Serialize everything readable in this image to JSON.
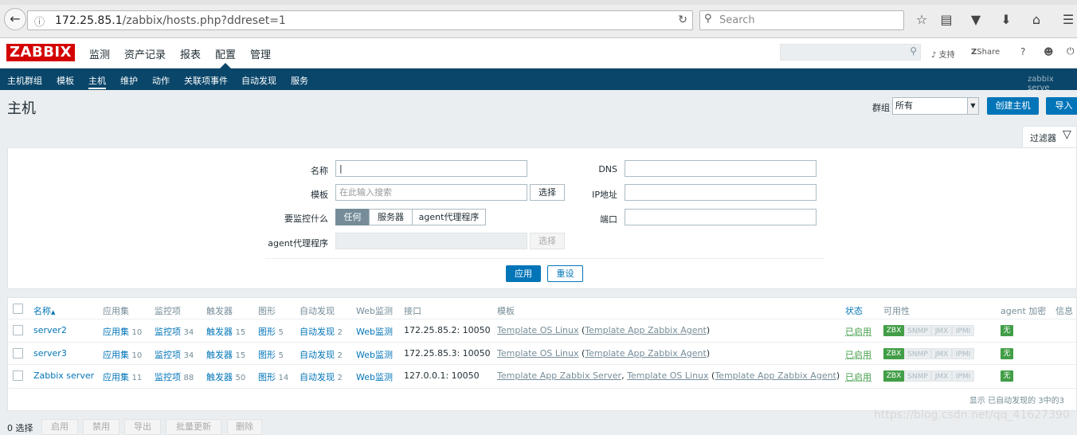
{
  "browser": {
    "url_host": "172.25.85.1",
    "url_path": "/zabbix/hosts.php?ddreset=1",
    "search_placeholder": "Search"
  },
  "topnav": {
    "logo": "ZABBIX",
    "menu": [
      "监测",
      "资产记录",
      "报表",
      "配置",
      "管理"
    ],
    "active": "配置",
    "support": "支持",
    "share": "Share",
    "help": "?"
  },
  "subnav": {
    "items": [
      "主机群组",
      "模板",
      "主机",
      "维护",
      "动作",
      "关联项事件",
      "自动发现",
      "服务"
    ],
    "active": "主机",
    "server_name": "zabbix serve"
  },
  "page": {
    "title": "主机",
    "group_label": "群组",
    "group_value": "所有",
    "create_button": "创建主机",
    "import_button": "导入"
  },
  "filter": {
    "tab_label": "过滤器",
    "name_label": "名称",
    "name_value": "|",
    "template_label": "模板",
    "template_placeholder": "在此输入搜索",
    "select_label": "选择",
    "monitored_by_label": "要监控什么",
    "monitored_by_options": [
      "任何",
      "服务器",
      "agent代理程序"
    ],
    "monitored_by_selected": "任何",
    "proxy_label": "agent代理程序",
    "dns_label": "DNS",
    "ip_label": "IP地址",
    "port_label": "端口",
    "apply_button": "应用",
    "reset_button": "重设"
  },
  "table": {
    "headers": [
      "名称",
      "应用集",
      "监控项",
      "触发器",
      "图形",
      "自动发现",
      "Web监测",
      "接口",
      "模板",
      "状态",
      "可用性",
      "agent 加密",
      "信息"
    ],
    "sort_indicator": "▲",
    "rows": [
      {
        "name": "server2",
        "apps": "应用集",
        "apps_n": "10",
        "items": "监控项",
        "items_n": "34",
        "triggers": "触发器",
        "triggers_n": "15",
        "graphs": "图形",
        "graphs_n": "5",
        "discovery": "自动发现",
        "discovery_n": "2",
        "web": "Web监测",
        "interface": "172.25.85.2: 10050",
        "templates": [
          {
            "t": "Template OS Linux",
            "u": true
          },
          {
            "t": " (",
            "u": false
          },
          {
            "t": "Template App Zabbix Agent",
            "u": true
          },
          {
            "t": ")",
            "u": false
          }
        ],
        "status": "已启用",
        "avail": [
          "ZBX",
          "SNMP",
          "JMX",
          "IPMI"
        ],
        "encryption": "无"
      },
      {
        "name": "server3",
        "apps": "应用集",
        "apps_n": "10",
        "items": "监控项",
        "items_n": "34",
        "triggers": "触发器",
        "triggers_n": "15",
        "graphs": "图形",
        "graphs_n": "5",
        "discovery": "自动发现",
        "discovery_n": "2",
        "web": "Web监测",
        "interface": "172.25.85.3: 10050",
        "templates": [
          {
            "t": "Template OS Linux",
            "u": true
          },
          {
            "t": " (",
            "u": false
          },
          {
            "t": "Template App Zabbix Agent",
            "u": true
          },
          {
            "t": ")",
            "u": false
          }
        ],
        "status": "已启用",
        "avail": [
          "ZBX",
          "SNMP",
          "JMX",
          "IPMI"
        ],
        "encryption": "无"
      },
      {
        "name": "Zabbix server",
        "apps": "应用集",
        "apps_n": "11",
        "items": "监控项",
        "items_n": "88",
        "triggers": "触发器",
        "triggers_n": "50",
        "graphs": "图形",
        "graphs_n": "14",
        "discovery": "自动发现",
        "discovery_n": "2",
        "web": "Web监测",
        "interface": "127.0.0.1: 10050",
        "templates": [
          {
            "t": "Template App Zabbix Server",
            "u": true
          },
          {
            "t": ", ",
            "u": false
          },
          {
            "t": "Template OS Linux",
            "u": true
          },
          {
            "t": " (",
            "u": false
          },
          {
            "t": "Template App Zabbix Agent",
            "u": true
          },
          {
            "t": ")",
            "u": false
          }
        ],
        "status": "已启用",
        "avail": [
          "ZBX",
          "SNMP",
          "JMX",
          "IPMI"
        ],
        "encryption": "无"
      }
    ],
    "footer": "显示 已自动发现的 3中的3"
  },
  "bottom": {
    "selected": "0 选择",
    "buttons": [
      "启用",
      "禁用",
      "导出",
      "批量更新",
      "删除"
    ]
  },
  "watermark": "https://blog.csdn.net/qq_41627390",
  "colors": {
    "brand_red": "#d40000",
    "nav_blue": "#0a466a",
    "link_blue": "#0275b8",
    "enabled_green": "#429e47"
  }
}
